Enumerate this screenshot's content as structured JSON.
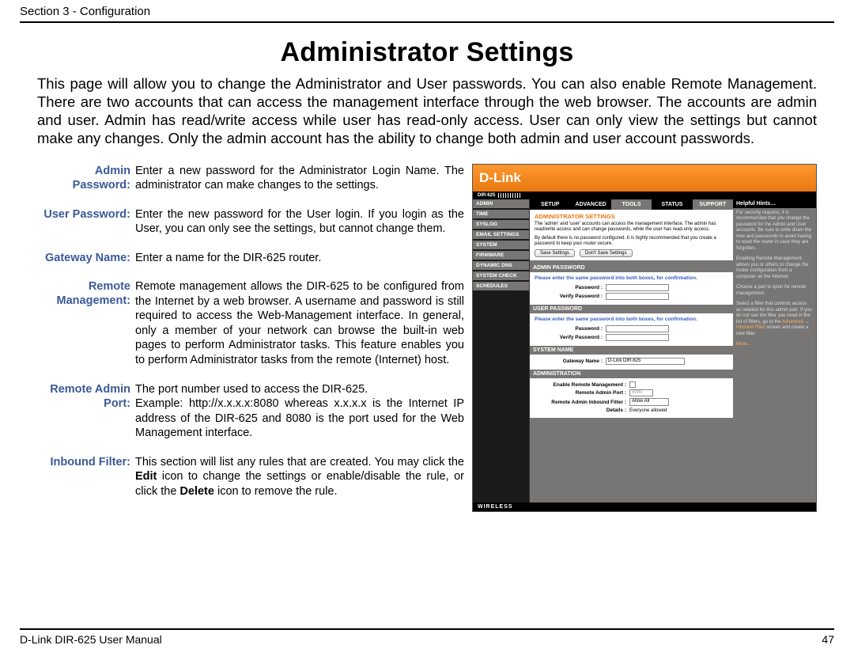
{
  "header": {
    "section": "Section 3 - Configuration"
  },
  "title": "Administrator Settings",
  "intro": "This page will allow you to change the Administrator and User passwords. You can also enable Remote Management. There are two accounts that can access the management interface through the web browser. The accounts are admin and user. Admin has read/write access while user has read-only access. User can only view the settings but cannot make any changes. Only the admin account has the ability to change both admin and user account passwords.",
  "defs": {
    "admin_pw_label": "Admin Password:",
    "admin_pw_text": "Enter a new password for the Administrator Login Name. The administrator can make changes to the settings.",
    "user_pw_label": "User Password:",
    "user_pw_text": "Enter the new password for the User login. If you login as the User, you can only see the settings, but cannot change them.",
    "gateway_label": "Gateway Name:",
    "gateway_text": "Enter a name for the DIR-625 router.",
    "remote_mgmt_label_1": "Remote",
    "remote_mgmt_label_2": "Management:",
    "remote_mgmt_text": "Remote management allows the DIR-625 to be configured from the Internet by a web browser. A username and password is still required to access the Web-Management interface. In general, only a member of your network can browse the built-in web pages to perform Administrator tasks. This feature enables you to perform Administrator tasks from the remote (Internet) host.",
    "remote_port_label_1": "Remote Admin",
    "remote_port_label_2": "Port:",
    "remote_port_text_1": "The port number used to access the DIR-625.",
    "remote_port_text_2": "Example: http://x.x.x.x:8080 whereas x.x.x.x is the Internet IP address of the DIR-625 and 8080 is the port used for the Web Management interface.",
    "inbound_label": "Inbound Filter:",
    "inbound_text_1": "This section will list any rules that are created. You may click the ",
    "inbound_bold_edit": "Edit",
    "inbound_text_2": " icon to change the settings or enable/disable the rule, or click the ",
    "inbound_bold_delete": "Delete",
    "inbound_text_3": " icon to remove the rule."
  },
  "ui": {
    "logo": "D-Link",
    "model": "DIR-625",
    "tabs": [
      "SETUP",
      "ADVANCED",
      "TOOLS",
      "STATUS",
      "SUPPORT"
    ],
    "active_tab": 2,
    "sidebar": [
      "ADMIN",
      "TIME",
      "SYSLOG",
      "EMAIL SETTINGS",
      "SYSTEM",
      "FIRMWARE",
      "DYNAMIC DNS",
      "SYSTEM CHECK",
      "SCHEDULES"
    ],
    "panel_title": "ADMINISTRATOR SETTINGS",
    "panel_text1": "The 'admin' and 'user' accounts can access the management interface. The admin has read/write access and can change passwords, while the user has read-only access.",
    "panel_text2": "By default there is no password configured. It is highly recommended that you create a password to keep your router secure.",
    "btn_save": "Save Settings",
    "btn_cancel": "Don't Save Settings",
    "strip_admin": "ADMIN PASSWORD",
    "hint_pw": "Please enter the same password into both boxes, for confirmation.",
    "lbl_password": "Password :",
    "lbl_verify": "Verify Password :",
    "strip_user": "USER PASSWORD",
    "strip_sys": "SYSTEM NAME",
    "lbl_gateway": "Gateway Name :",
    "gateway_value": "D-Link DIR-625",
    "strip_admin2": "ADMINISTRATION",
    "lbl_enable_remote": "Enable Remote Management :",
    "lbl_remote_port": "Remote Admin Port :",
    "remote_port_value": "8080",
    "lbl_inbound": "Remote Admin Inbound Filter :",
    "inbound_value": "Allow All",
    "lbl_details": "Details :",
    "details_value": "Everyone allowed",
    "hints_title": "Helpful Hints…",
    "hints_1": "For security reasons, it is recommended that you change the password for the Admin and User accounts. Be sure to write down the new and passwords to avoid having to reset the router in case they are forgotten.",
    "hints_2": "Enabling Remote Management, allows you or others to change the router configuration from a computer on the Internet.",
    "hints_3": "Choose a port to open for remote management.",
    "hints_4_a": "Select a filter that controls access as needed for this admin port. If you do not see the filter you need in the list of filters, go to the ",
    "hints_4_link1": "Advanced",
    "hints_4_arrow": " → ",
    "hints_4_link2": "Inbound Filter",
    "hints_4_b": " screen and create a new filter.",
    "hints_more": "More…",
    "footer_strip": "WIRELESS"
  },
  "footer": {
    "left": "D-Link DIR-625 User Manual",
    "right": "47"
  }
}
